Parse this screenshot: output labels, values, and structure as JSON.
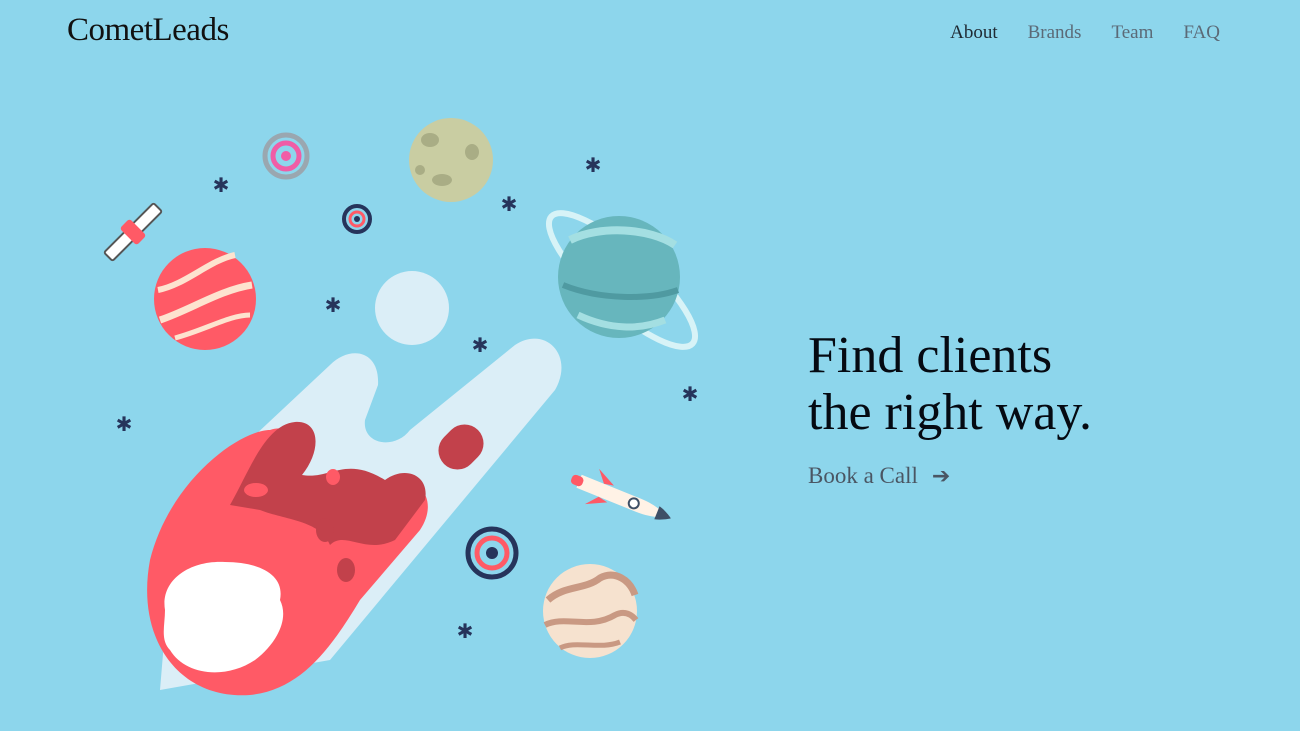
{
  "header": {
    "logo": "CometLeads",
    "nav": [
      {
        "label": "About",
        "active": true
      },
      {
        "label": "Brands",
        "active": false
      },
      {
        "label": "Team",
        "active": false
      },
      {
        "label": "FAQ",
        "active": false
      }
    ]
  },
  "hero": {
    "title_line1": "Find clients",
    "title_line2": "the right way.",
    "cta_label": "Book a Call",
    "cta_icon": "arrow-right-icon"
  },
  "colors": {
    "background": "#8dd6ec",
    "comet_red": "#ff5a66",
    "comet_dark": "#c2414b",
    "trail": "#dbeef7",
    "star": "#26345b"
  }
}
